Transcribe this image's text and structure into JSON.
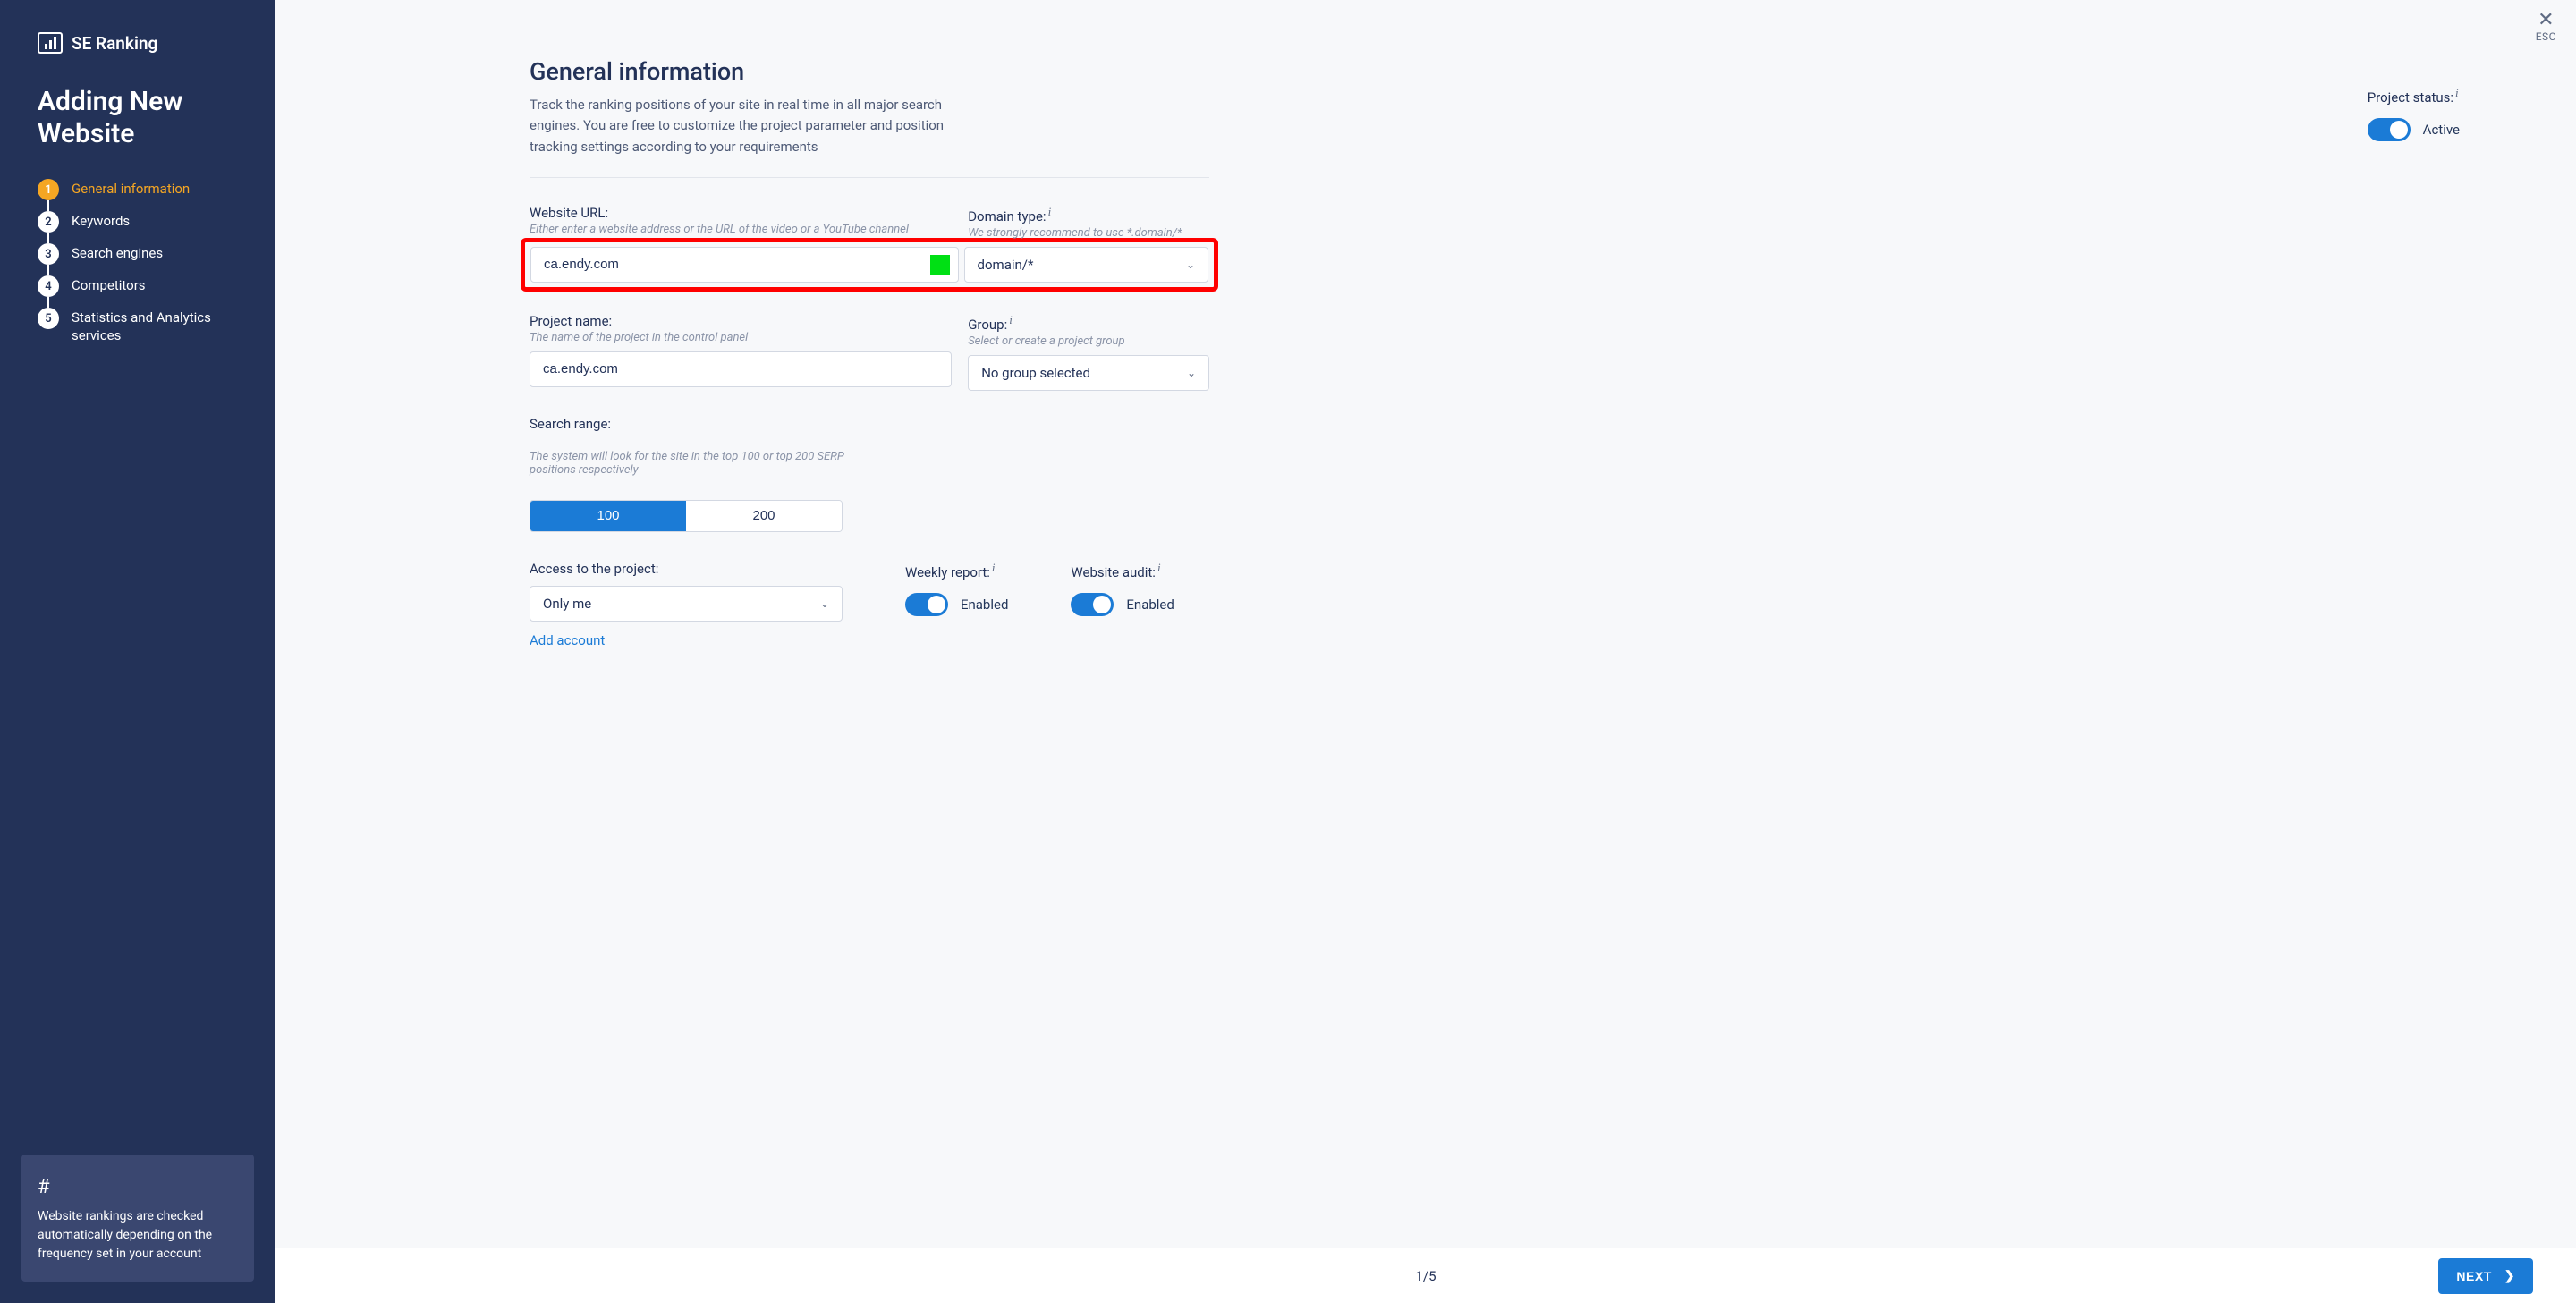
{
  "brand": "SE Ranking",
  "page_title": "Adding New Website",
  "steps": [
    {
      "num": "1",
      "label": "General information",
      "active": true
    },
    {
      "num": "2",
      "label": "Keywords",
      "active": false
    },
    {
      "num": "3",
      "label": "Search engines",
      "active": false
    },
    {
      "num": "4",
      "label": "Competitors",
      "active": false
    },
    {
      "num": "5",
      "label": "Statistics and Analytics services",
      "active": false
    }
  ],
  "tip": {
    "symbol": "#",
    "text": "Website rankings are checked automatically depending on the frequency set in your account"
  },
  "close_label": "ESC",
  "header": {
    "title": "General information",
    "desc": "Track the ranking positions of your site in real time in all major search engines. You are free to customize the project parameter and position tracking settings according to your requirements"
  },
  "status": {
    "label": "Project status:",
    "value": "Active"
  },
  "fields": {
    "url": {
      "label": "Website URL:",
      "hint": "Either enter a website address or the URL of the video or a YouTube channel",
      "value": "ca.endy.com"
    },
    "domain_type": {
      "label": "Domain type:",
      "hint": "We strongly recommend to use *.domain/*",
      "value": "domain/*"
    },
    "project_name": {
      "label": "Project name:",
      "hint": "The name of the project in the control panel",
      "value": "ca.endy.com"
    },
    "group": {
      "label": "Group:",
      "hint": "Select or create a project group",
      "value": "No group selected"
    },
    "search_range": {
      "label": "Search range:",
      "hint": "The system will look for the site in the top 100 or top 200 SERP positions respectively",
      "options": [
        "100",
        "200"
      ],
      "selected": "100"
    },
    "access": {
      "label": "Access to the project:",
      "value": "Only me",
      "add_label": "Add account"
    },
    "weekly_report": {
      "label": "Weekly report:",
      "value": "Enabled"
    },
    "website_audit": {
      "label": "Website audit:",
      "value": "Enabled"
    }
  },
  "footer": {
    "page_current": "1",
    "page_total": "5",
    "next_label": "NEXT"
  }
}
